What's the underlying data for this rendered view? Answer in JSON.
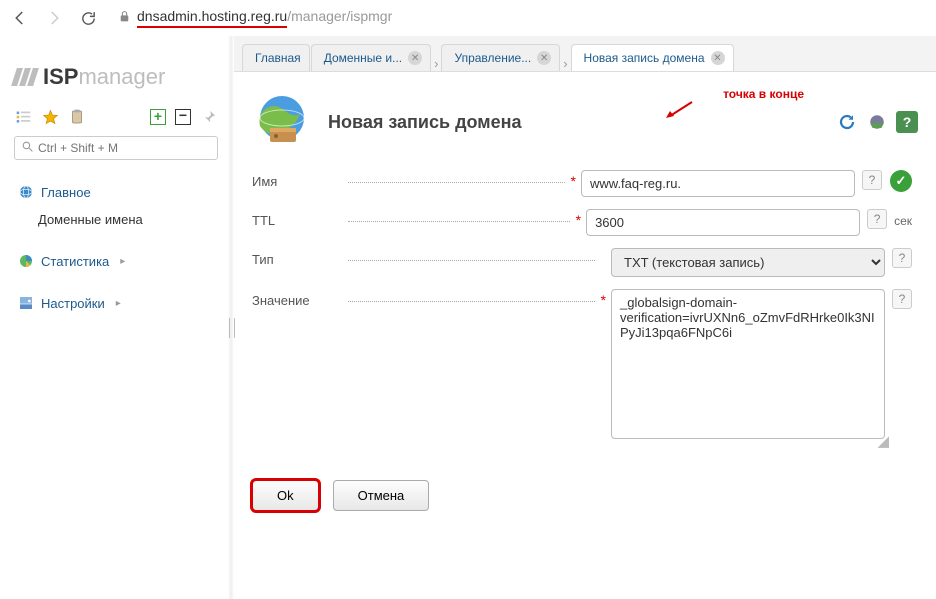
{
  "browser": {
    "url_host": "dnsadmin.hosting.reg.ru",
    "url_path": "/manager/ispmgr"
  },
  "logo": {
    "isp": "ISP",
    "mgr": "manager"
  },
  "toolbar_search_placeholder": "Ctrl + Shift + M",
  "sidebar": {
    "items": [
      {
        "label": "Главное"
      },
      {
        "label": "Доменные имена"
      },
      {
        "label": "Статистика"
      },
      {
        "label": "Настройки"
      }
    ]
  },
  "tabs": [
    {
      "label": "Главная"
    },
    {
      "label": "Доменные и..."
    },
    {
      "label": "Управление..."
    },
    {
      "label": "Новая запись домена"
    }
  ],
  "page_title": "Новая запись домена",
  "annotation": "точка в конце",
  "form": {
    "name": {
      "label": "Имя",
      "value": "www.faq-reg.ru."
    },
    "ttl": {
      "label": "TTL",
      "value": "3600",
      "suffix": "сек"
    },
    "type": {
      "label": "Тип",
      "value": "TXT (текстовая запись)"
    },
    "znach": {
      "label": "Значение",
      "value": "_globalsign-domain-verification=ivrUXNn6_oZmvFdRHrke0Ik3NIPyJi13pqa6FNpC6i"
    }
  },
  "buttons": {
    "ok": "Ok",
    "cancel": "Отмена"
  }
}
